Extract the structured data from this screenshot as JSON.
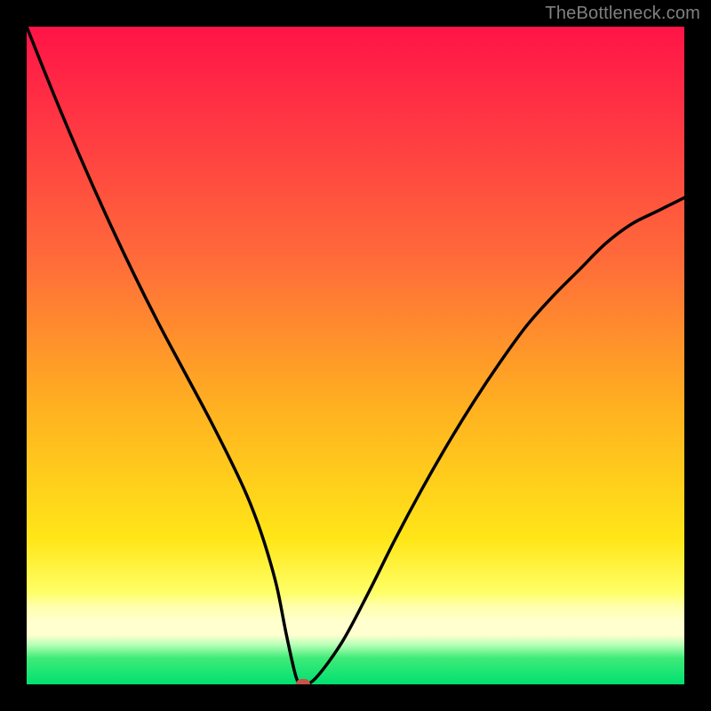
{
  "watermark": "TheBottleneck.com",
  "colors": {
    "frame": "#000000",
    "curve": "#000000",
    "marker": "#c9524b",
    "watermark": "#808080"
  },
  "chart_data": {
    "type": "line",
    "title": "",
    "xlabel": "",
    "ylabel": "",
    "xlim": [
      0,
      100
    ],
    "ylim": [
      0,
      100
    ],
    "grid": false,
    "series": [
      {
        "name": "bottleneck-curve",
        "x": [
          0,
          4,
          8,
          12,
          16,
          20,
          24,
          28,
          32,
          34,
          36,
          38,
          39.5,
          41,
          42,
          44,
          48,
          52,
          56,
          60,
          64,
          68,
          72,
          76,
          80,
          84,
          88,
          92,
          96,
          100
        ],
        "y": [
          100,
          90,
          80.5,
          71.5,
          63,
          55,
          47.5,
          40,
          32,
          27.5,
          22,
          15,
          7.5,
          1,
          0,
          1,
          6.5,
          14,
          22,
          29.5,
          36.5,
          43,
          49,
          54.5,
          59,
          63,
          67,
          70,
          72,
          74
        ]
      }
    ],
    "annotations": [
      {
        "name": "min-marker",
        "x": 42,
        "y": 0
      }
    ]
  }
}
